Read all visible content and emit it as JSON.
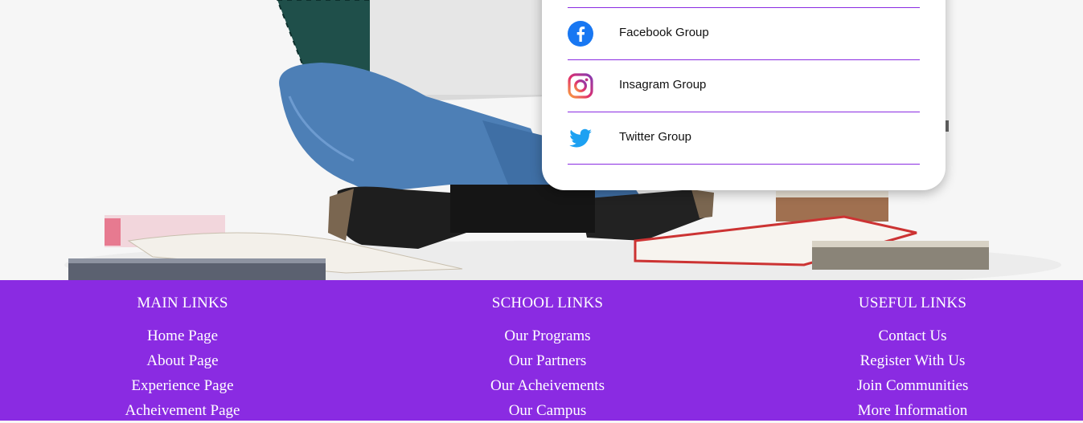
{
  "social": {
    "items": [
      {
        "label": "Facebook Group",
        "icon": "facebook-icon"
      },
      {
        "label": "Insagram Group",
        "icon": "instagram-icon"
      },
      {
        "label": "Twitter Group",
        "icon": "twitter-icon"
      }
    ]
  },
  "footer": {
    "columns": [
      {
        "title": "MAIN LINKS",
        "links": [
          "Home Page",
          "About Page",
          "Experience Page",
          "Acheivement Page"
        ]
      },
      {
        "title": "SCHOOL LINKS",
        "links": [
          "Our Programs",
          "Our Partners",
          "Our Acheivements",
          "Our Campus"
        ]
      },
      {
        "title": "USEFUL LINKS",
        "links": [
          "Contact Us",
          "Register With Us",
          "Join Communities",
          "More Information"
        ]
      }
    ]
  },
  "colors": {
    "accent": "#8a2be2",
    "facebook": "#1877f2",
    "twitter": "#1da1f2"
  }
}
